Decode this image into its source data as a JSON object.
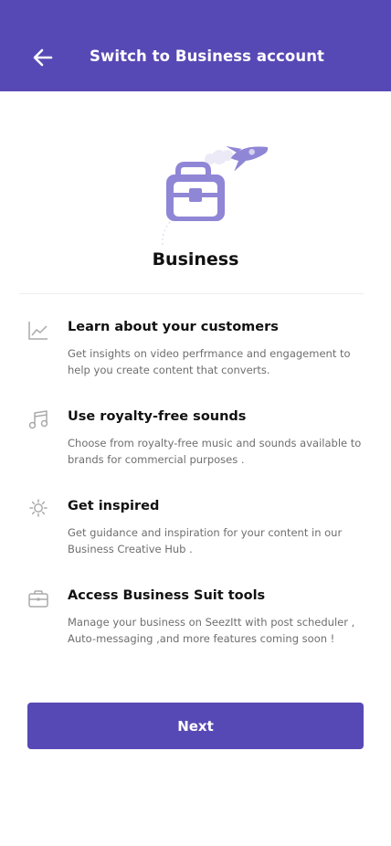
{
  "header": {
    "title": "Switch to Business account",
    "back_icon": "arrow-left-icon",
    "background": "#5749b5"
  },
  "hero": {
    "title": "Business",
    "illustration": "briefcase-with-rocket-illustration",
    "illustration_color": "#8f86d6"
  },
  "features": [
    {
      "icon": "line-chart-icon",
      "title": "Learn about your customers",
      "description": "Get insights on video perfrmance and engagement to help you create content that converts."
    },
    {
      "icon": "music-note-icon",
      "title": "Use royalty-free sounds",
      "description": "Choose from royalty-free music and sounds available to brands for commercial purposes ."
    },
    {
      "icon": "sun-icon",
      "title": "Get inspired",
      "description": "Get guidance and inspiration for your content in our Business Creative Hub ."
    },
    {
      "icon": "briefcase-icon",
      "title": "Access Business Suit tools",
      "description": "Manage your business on SeezItt with post scheduler , Auto-messaging ,and more features coming soon !"
    }
  ],
  "actions": {
    "next_label": "Next",
    "button_color": "#5749b5"
  }
}
